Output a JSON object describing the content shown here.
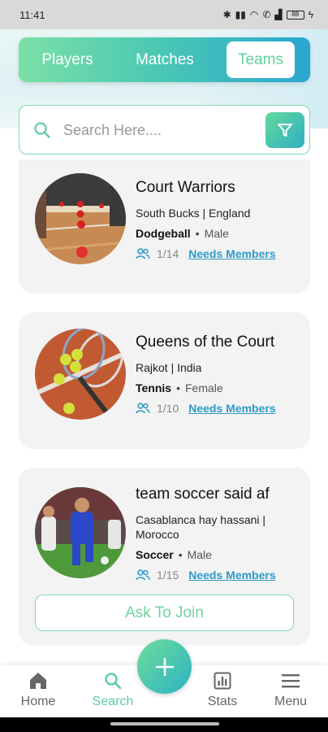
{
  "status_bar": {
    "time": "11:41",
    "battery": "88"
  },
  "tabs": [
    {
      "label": "Players",
      "active": false
    },
    {
      "label": "Matches",
      "active": false
    },
    {
      "label": "Teams",
      "active": true
    }
  ],
  "search": {
    "placeholder": "Search Here...."
  },
  "teams": [
    {
      "name": "Court Warriors",
      "location": "South Bucks | England",
      "sport": "Dodgeball",
      "gender": "Male",
      "members": "1/14",
      "status": "Needs Members"
    },
    {
      "name": "Queens of the Court",
      "location": "Rajkot  | India",
      "sport": "Tennis",
      "gender": "Female",
      "members": "1/10",
      "status": "Needs Members"
    },
    {
      "name": "team soccer said af",
      "location": "Casablanca hay hassani  | Morocco",
      "sport": "Soccer",
      "gender": "Male",
      "members": "1/15",
      "status": "Needs Members",
      "join_label": "Ask To Join"
    }
  ],
  "bottom_nav": [
    {
      "label": "Home",
      "icon": "home-icon"
    },
    {
      "label": "Search",
      "icon": "search-icon",
      "active": true
    },
    {
      "label": "Stats",
      "icon": "stats-icon"
    },
    {
      "label": "Menu",
      "icon": "menu-icon"
    }
  ],
  "colors": {
    "accent_green": "#6fd3a1",
    "accent_blue": "#2d9bc9",
    "card_bg": "#f3f3f3"
  }
}
